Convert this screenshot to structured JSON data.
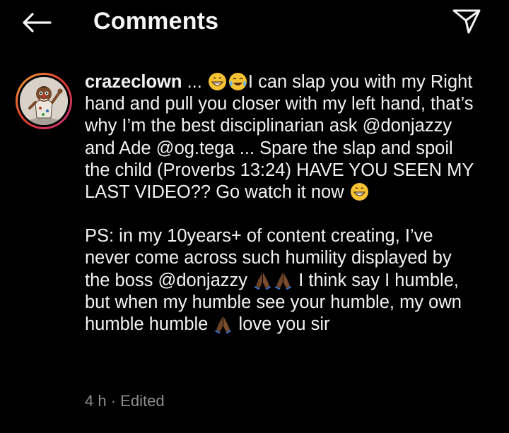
{
  "header": {
    "title": "Comments",
    "back_icon": "back-arrow-icon",
    "share_icon": "paper-plane-icon"
  },
  "comment": {
    "username": "crazeclown",
    "p1_a": " ... ",
    "p1_b": "I can slap you with my Right hand and pull you closer with my left hand, that’s why I’m the best disciplinarian ask @donjazzy and Ade @og.tega ... Spare the slap and spoil the child (Proverbs 13:24) HAVE YOU SEEN MY LAST VIDEO?? Go watch it now ",
    "p2_a": "PS: in my 10years+ of content creating, I’ve never come across such humility displayed by the boss @donjazzy ",
    "p2_b": " I think say I humble, but when my humble see your humble, my own humble humble ",
    "p2_c": " love you sir",
    "time": "4 h",
    "separator": "·",
    "edited": "Edited"
  },
  "colors": {
    "background": "#000000",
    "text": "#f2f2f2",
    "meta": "#8e8e8e",
    "story_ring_start": "#f6a93b",
    "story_ring_end": "#c22b7a"
  }
}
